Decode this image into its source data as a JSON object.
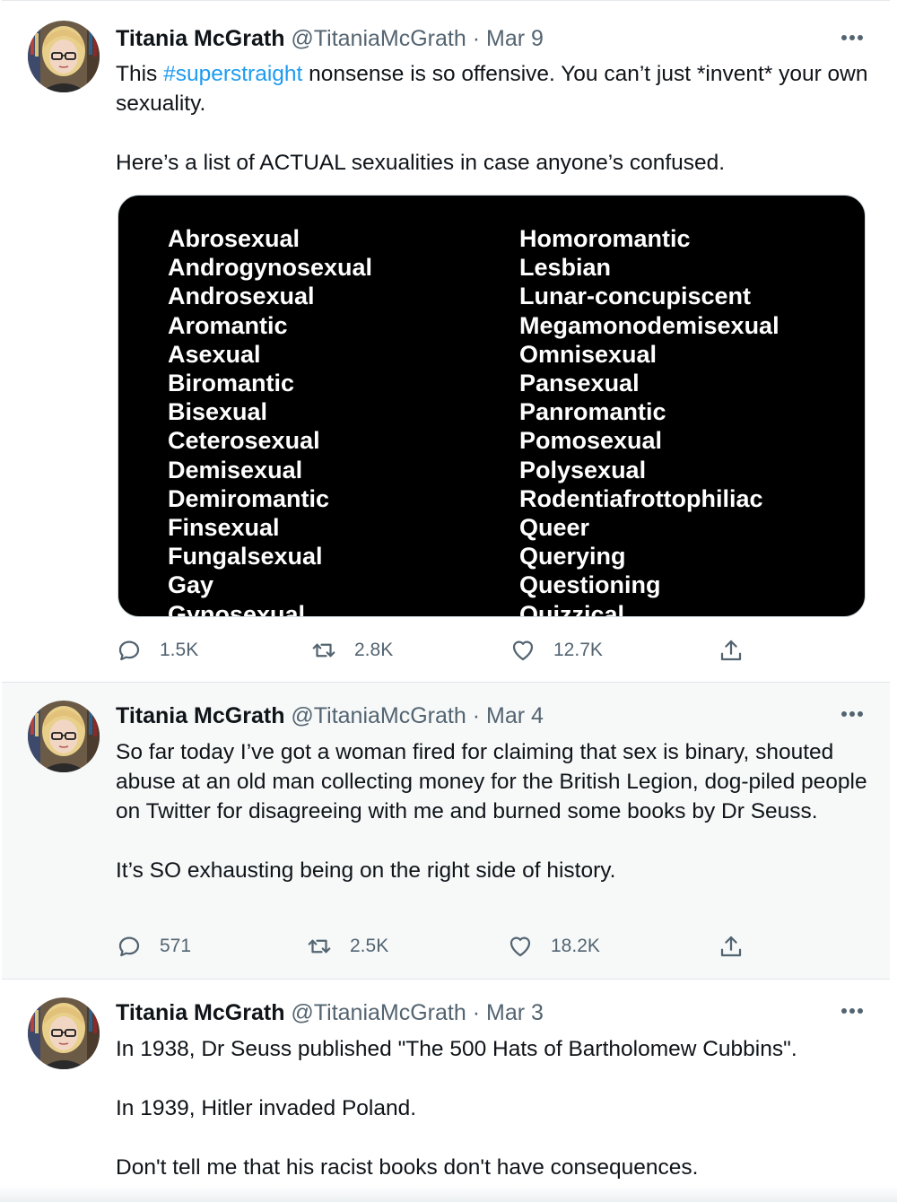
{
  "colors": {
    "link": "#1d9bf0",
    "secondary": "#536471",
    "text": "#0f1419"
  },
  "tweets": [
    {
      "name": "Titania McGrath",
      "handle": "@TitaniaMcGrath",
      "date": "Mar 9",
      "text_parts": [
        "This ",
        "#superstraight",
        " nonsense is so offensive. You can’t just *invent* your own sexuality."
      ],
      "text2": "Here’s a list of ACTUAL sexualities in case anyone’s confused.",
      "image_list_left": [
        "Abrosexual",
        "Androgynosexual",
        "Androsexual",
        "Aromantic",
        "Asexual",
        "Biromantic",
        "Bisexual",
        "Ceterosexual",
        "Demisexual",
        "Demiromantic",
        "Finsexual",
        "Fungalsexual",
        "Gay",
        "Gynosexual"
      ],
      "image_list_right": [
        "Homoromantic",
        "Lesbian",
        "Lunar-concupiscent",
        "Megamonodemisexual",
        "Omnisexual",
        "Pansexual",
        "Panromantic",
        "Pomosexual",
        "Polysexual",
        "Rodentiafrottophiliac",
        "Queer",
        "Querying",
        "Questioning",
        "Quizzical"
      ],
      "replies": "1.5K",
      "retweets": "2.8K",
      "likes": "12.7K"
    },
    {
      "name": "Titania McGrath",
      "handle": "@TitaniaMcGrath",
      "date": "Mar 4",
      "text": "So far today I’ve got a woman fired for claiming that sex is binary, shouted abuse at an old man collecting money for the British Legion, dog-piled people on Twitter for disagreeing with me and burned some books by Dr Seuss.",
      "text2": "It’s SO exhausting being on the right side of history.",
      "replies": "571",
      "retweets": "2.5K",
      "likes": "18.2K"
    },
    {
      "name": "Titania McGrath",
      "handle": "@TitaniaMcGrath",
      "date": "Mar 3",
      "text": "In 1938, Dr Seuss published \"The 500 Hats of Bartholomew Cubbins\".",
      "text2": "In 1939, Hitler invaded Poland.",
      "text3": "Don't tell me that his racist books don't have consequences."
    }
  ],
  "icons": {
    "reply": "reply-icon",
    "retweet": "retweet-icon",
    "like": "heart-icon",
    "share": "share-icon",
    "more": "more-icon"
  }
}
